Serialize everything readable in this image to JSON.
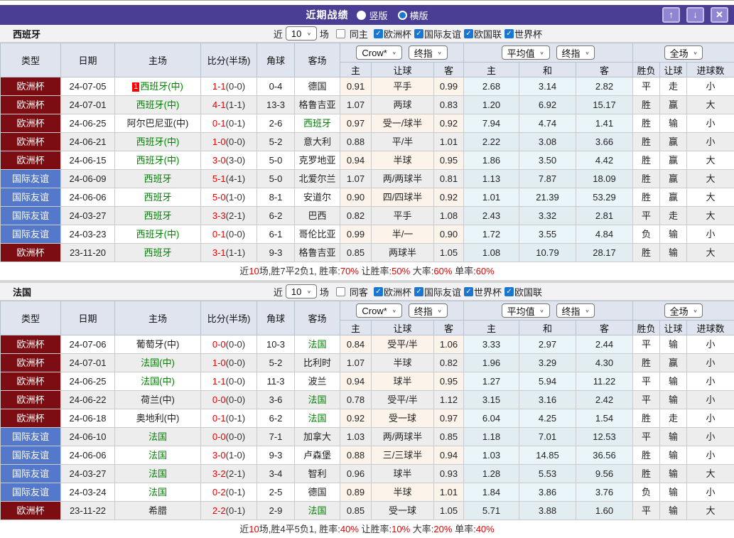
{
  "topbar": {
    "title": "近期战绩",
    "radio_vertical": "竖版",
    "radio_horizontal": "横版"
  },
  "icons": {
    "check": "✓",
    "chevron": "∨",
    "up": "↑",
    "down": "↓",
    "close": "✕"
  },
  "filter": {
    "near": "近",
    "count": "10",
    "matches": "场"
  },
  "header": {
    "static_cols": [
      "类型",
      "日期",
      "主场",
      "比分(半场)",
      "角球",
      "客场"
    ],
    "g1": {
      "dd1": "Crow*",
      "dd2": "终指",
      "cols": [
        "主",
        "让球",
        "客"
      ]
    },
    "g2": {
      "dd1": "平均值",
      "dd2": "终指",
      "cols": [
        "主",
        "和",
        "客"
      ]
    },
    "g3": {
      "dd1": "全场",
      "cols": [
        "胜负",
        "让球",
        "进球数"
      ]
    }
  },
  "result_colors": {
    "胜": "red",
    "赢": "red",
    "大": "red",
    "平": "green",
    "走": "green",
    "负": "blue",
    "输": "blue",
    "小": "blue"
  },
  "sections": [
    {
      "team": "西班牙",
      "same_label": "同主",
      "competitions": [
        "欧洲杯",
        "国际友谊",
        "欧国联",
        "世界杯"
      ],
      "rows": [
        {
          "type": "欧洲杯",
          "type_class": "euro",
          "date": "24-07-05",
          "badge": "1",
          "home": "西班牙(中)",
          "home_green": true,
          "score": "1-1",
          "half": "(0-0)",
          "corner": "0-4",
          "away": "德国",
          "away_green": false,
          "ah_home": "0.91",
          "ah_line": "平手",
          "ah_away": "0.99",
          "eu_home": "2.68",
          "eu_draw": "3.14",
          "eu_away": "2.82",
          "res_win": "平",
          "res_handicap": "走",
          "res_goals": "小"
        },
        {
          "type": "欧洲杯",
          "type_class": "euro",
          "date": "24-07-01",
          "badge": "",
          "home": "西班牙(中)",
          "home_green": true,
          "score": "4-1",
          "half": "(1-1)",
          "corner": "13-3",
          "away": "格鲁吉亚",
          "away_green": false,
          "ah_home": "1.07",
          "ah_line": "两球",
          "ah_away": "0.83",
          "eu_home": "1.20",
          "eu_draw": "6.92",
          "eu_away": "15.17",
          "res_win": "胜",
          "res_handicap": "赢",
          "res_goals": "大"
        },
        {
          "type": "欧洲杯",
          "type_class": "euro",
          "date": "24-06-25",
          "badge": "",
          "home": "阿尔巴尼亚(中)",
          "home_green": false,
          "score": "0-1",
          "half": "(0-1)",
          "corner": "2-6",
          "away": "西班牙",
          "away_green": true,
          "ah_home": "0.97",
          "ah_line": "受一/球半",
          "ah_away": "0.92",
          "eu_home": "7.94",
          "eu_draw": "4.74",
          "eu_away": "1.41",
          "res_win": "胜",
          "res_handicap": "输",
          "res_goals": "小"
        },
        {
          "type": "欧洲杯",
          "type_class": "euro",
          "date": "24-06-21",
          "badge": "",
          "home": "西班牙(中)",
          "home_green": true,
          "score": "1-0",
          "half": "(0-0)",
          "corner": "5-2",
          "away": "意大利",
          "away_green": false,
          "ah_home": "0.88",
          "ah_line": "平/半",
          "ah_away": "1.01",
          "eu_home": "2.22",
          "eu_draw": "3.08",
          "eu_away": "3.66",
          "res_win": "胜",
          "res_handicap": "赢",
          "res_goals": "小"
        },
        {
          "type": "欧洲杯",
          "type_class": "euro",
          "date": "24-06-15",
          "badge": "",
          "home": "西班牙(中)",
          "home_green": true,
          "score": "3-0",
          "half": "(3-0)",
          "corner": "5-0",
          "away": "克罗地亚",
          "away_green": false,
          "ah_home": "0.94",
          "ah_line": "半球",
          "ah_away": "0.95",
          "eu_home": "1.86",
          "eu_draw": "3.50",
          "eu_away": "4.42",
          "res_win": "胜",
          "res_handicap": "赢",
          "res_goals": "大"
        },
        {
          "type": "国际友谊",
          "type_class": "friendly",
          "date": "24-06-09",
          "badge": "",
          "home": "西班牙",
          "home_green": true,
          "score": "5-1",
          "half": "(4-1)",
          "corner": "5-0",
          "away": "北爱尔兰",
          "away_green": false,
          "ah_home": "1.07",
          "ah_line": "两/两球半",
          "ah_away": "0.81",
          "eu_home": "1.13",
          "eu_draw": "7.87",
          "eu_away": "18.09",
          "res_win": "胜",
          "res_handicap": "赢",
          "res_goals": "大"
        },
        {
          "type": "国际友谊",
          "type_class": "friendly",
          "date": "24-06-06",
          "badge": "",
          "home": "西班牙",
          "home_green": true,
          "score": "5-0",
          "half": "(1-0)",
          "corner": "8-1",
          "away": "安道尔",
          "away_green": false,
          "ah_home": "0.90",
          "ah_line": "四/四球半",
          "ah_away": "0.92",
          "eu_home": "1.01",
          "eu_draw": "21.39",
          "eu_away": "53.29",
          "res_win": "胜",
          "res_handicap": "赢",
          "res_goals": "大"
        },
        {
          "type": "国际友谊",
          "type_class": "friendly",
          "date": "24-03-27",
          "badge": "",
          "home": "西班牙",
          "home_green": true,
          "score": "3-3",
          "half": "(2-1)",
          "corner": "6-2",
          "away": "巴西",
          "away_green": false,
          "ah_home": "0.82",
          "ah_line": "平手",
          "ah_away": "1.08",
          "eu_home": "2.43",
          "eu_draw": "3.32",
          "eu_away": "2.81",
          "res_win": "平",
          "res_handicap": "走",
          "res_goals": "大"
        },
        {
          "type": "国际友谊",
          "type_class": "friendly",
          "date": "24-03-23",
          "badge": "",
          "home": "西班牙(中)",
          "home_green": true,
          "score": "0-1",
          "half": "(0-0)",
          "corner": "6-1",
          "away": "哥伦比亚",
          "away_green": false,
          "ah_home": "0.99",
          "ah_line": "半/一",
          "ah_away": "0.90",
          "eu_home": "1.72",
          "eu_draw": "3.55",
          "eu_away": "4.84",
          "res_win": "负",
          "res_handicap": "输",
          "res_goals": "小"
        },
        {
          "type": "欧洲杯",
          "type_class": "euro",
          "date": "23-11-20",
          "badge": "",
          "home": "西班牙",
          "home_green": true,
          "score": "3-1",
          "half": "(1-1)",
          "corner": "9-3",
          "away": "格鲁吉亚",
          "away_green": false,
          "ah_home": "0.85",
          "ah_line": "两球半",
          "ah_away": "1.05",
          "eu_home": "1.08",
          "eu_draw": "10.79",
          "eu_away": "28.17",
          "res_win": "胜",
          "res_handicap": "输",
          "res_goals": "大"
        }
      ],
      "summary": [
        {
          "t": "近",
          "r": false
        },
        {
          "t": "10",
          "r": true
        },
        {
          "t": "场,胜7平2负1, 胜率:",
          "r": false
        },
        {
          "t": "70%",
          "r": true
        },
        {
          "t": " 让胜率:",
          "r": false
        },
        {
          "t": "50%",
          "r": true
        },
        {
          "t": " 大率:",
          "r": false
        },
        {
          "t": "60%",
          "r": true
        },
        {
          "t": " 单率:",
          "r": false
        },
        {
          "t": "60%",
          "r": true
        }
      ]
    },
    {
      "team": "法国",
      "same_label": "同客",
      "competitions": [
        "欧洲杯",
        "国际友谊",
        "世界杯",
        "欧国联"
      ],
      "rows": [
        {
          "type": "欧洲杯",
          "type_class": "euro",
          "date": "24-07-06",
          "badge": "",
          "home": "葡萄牙(中)",
          "home_green": false,
          "score": "0-0",
          "half": "(0-0)",
          "corner": "10-3",
          "away": "法国",
          "away_green": true,
          "ah_home": "0.84",
          "ah_line": "受平/半",
          "ah_away": "1.06",
          "eu_home": "3.33",
          "eu_draw": "2.97",
          "eu_away": "2.44",
          "res_win": "平",
          "res_handicap": "输",
          "res_goals": "小"
        },
        {
          "type": "欧洲杯",
          "type_class": "euro",
          "date": "24-07-01",
          "badge": "",
          "home": "法国(中)",
          "home_green": true,
          "score": "1-0",
          "half": "(0-0)",
          "corner": "5-2",
          "away": "比利时",
          "away_green": false,
          "ah_home": "1.07",
          "ah_line": "半球",
          "ah_away": "0.82",
          "eu_home": "1.96",
          "eu_draw": "3.29",
          "eu_away": "4.30",
          "res_win": "胜",
          "res_handicap": "赢",
          "res_goals": "小"
        },
        {
          "type": "欧洲杯",
          "type_class": "euro",
          "date": "24-06-25",
          "badge": "",
          "home": "法国(中)",
          "home_green": true,
          "score": "1-1",
          "half": "(0-0)",
          "corner": "11-3",
          "away": "波兰",
          "away_green": false,
          "ah_home": "0.94",
          "ah_line": "球半",
          "ah_away": "0.95",
          "eu_home": "1.27",
          "eu_draw": "5.94",
          "eu_away": "11.22",
          "res_win": "平",
          "res_handicap": "输",
          "res_goals": "小"
        },
        {
          "type": "欧洲杯",
          "type_class": "euro",
          "date": "24-06-22",
          "badge": "",
          "home": "荷兰(中)",
          "home_green": false,
          "score": "0-0",
          "half": "(0-0)",
          "corner": "3-6",
          "away": "法国",
          "away_green": true,
          "ah_home": "0.78",
          "ah_line": "受平/半",
          "ah_away": "1.12",
          "eu_home": "3.15",
          "eu_draw": "3.16",
          "eu_away": "2.42",
          "res_win": "平",
          "res_handicap": "输",
          "res_goals": "小"
        },
        {
          "type": "欧洲杯",
          "type_class": "euro",
          "date": "24-06-18",
          "badge": "",
          "home": "奥地利(中)",
          "home_green": false,
          "score": "0-1",
          "half": "(0-1)",
          "corner": "6-2",
          "away": "法国",
          "away_green": true,
          "ah_home": "0.92",
          "ah_line": "受一球",
          "ah_away": "0.97",
          "eu_home": "6.04",
          "eu_draw": "4.25",
          "eu_away": "1.54",
          "res_win": "胜",
          "res_handicap": "走",
          "res_goals": "小"
        },
        {
          "type": "国际友谊",
          "type_class": "friendly",
          "date": "24-06-10",
          "badge": "",
          "home": "法国",
          "home_green": true,
          "score": "0-0",
          "half": "(0-0)",
          "corner": "7-1",
          "away": "加拿大",
          "away_green": false,
          "ah_home": "1.03",
          "ah_line": "两/两球半",
          "ah_away": "0.85",
          "eu_home": "1.18",
          "eu_draw": "7.01",
          "eu_away": "12.53",
          "res_win": "平",
          "res_handicap": "输",
          "res_goals": "小"
        },
        {
          "type": "国际友谊",
          "type_class": "friendly",
          "date": "24-06-06",
          "badge": "",
          "home": "法国",
          "home_green": true,
          "score": "3-0",
          "half": "(1-0)",
          "corner": "9-3",
          "away": "卢森堡",
          "away_green": false,
          "ah_home": "0.88",
          "ah_line": "三/三球半",
          "ah_away": "0.94",
          "eu_home": "1.03",
          "eu_draw": "14.85",
          "eu_away": "36.56",
          "res_win": "胜",
          "res_handicap": "输",
          "res_goals": "小"
        },
        {
          "type": "国际友谊",
          "type_class": "friendly",
          "date": "24-03-27",
          "badge": "",
          "home": "法国",
          "home_green": true,
          "score": "3-2",
          "half": "(2-1)",
          "corner": "3-4",
          "away": "智利",
          "away_green": false,
          "ah_home": "0.96",
          "ah_line": "球半",
          "ah_away": "0.93",
          "eu_home": "1.28",
          "eu_draw": "5.53",
          "eu_away": "9.56",
          "res_win": "胜",
          "res_handicap": "输",
          "res_goals": "大"
        },
        {
          "type": "国际友谊",
          "type_class": "friendly",
          "date": "24-03-24",
          "badge": "",
          "home": "法国",
          "home_green": true,
          "score": "0-2",
          "half": "(0-1)",
          "corner": "2-5",
          "away": "德国",
          "away_green": false,
          "ah_home": "0.89",
          "ah_line": "半球",
          "ah_away": "1.01",
          "eu_home": "1.84",
          "eu_draw": "3.86",
          "eu_away": "3.76",
          "res_win": "负",
          "res_handicap": "输",
          "res_goals": "小"
        },
        {
          "type": "欧洲杯",
          "type_class": "euro",
          "date": "23-11-22",
          "badge": "",
          "home": "希腊",
          "home_green": false,
          "score": "2-2",
          "half": "(0-1)",
          "corner": "2-9",
          "away": "法国",
          "away_green": true,
          "ah_home": "0.85",
          "ah_line": "受一球",
          "ah_away": "1.05",
          "eu_home": "5.71",
          "eu_draw": "3.88",
          "eu_away": "1.60",
          "res_win": "平",
          "res_handicap": "输",
          "res_goals": "大"
        }
      ],
      "summary": [
        {
          "t": "近",
          "r": false
        },
        {
          "t": "10",
          "r": true
        },
        {
          "t": "场,胜4平5负1, 胜率:",
          "r": false
        },
        {
          "t": "40%",
          "r": true
        },
        {
          "t": " 让胜率:",
          "r": false
        },
        {
          "t": "10%",
          "r": true
        },
        {
          "t": " 大率:",
          "r": false
        },
        {
          "t": "20%",
          "r": true
        },
        {
          "t": " 单率:",
          "r": false
        },
        {
          "t": "40%",
          "r": true
        }
      ]
    }
  ]
}
